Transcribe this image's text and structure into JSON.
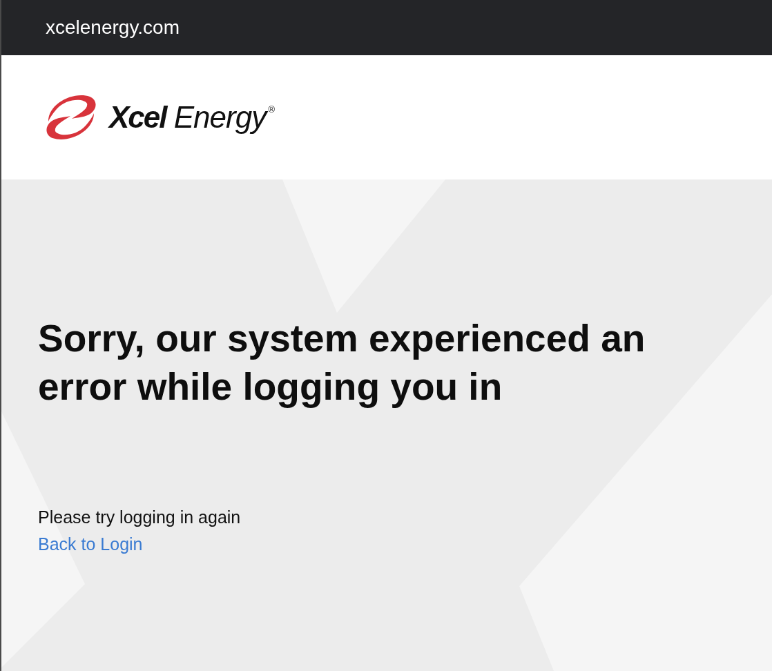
{
  "browser_bar": {
    "url": "xcelenergy.com"
  },
  "header": {
    "logo": {
      "wordmark": "**Xcel** Energy$^{®}$"
    }
  },
  "error": {
    "heading": "Sorry, our system experienced an error while logging you in",
    "message": "Please try logging in again",
    "link": "Back to Login"
  }
}
